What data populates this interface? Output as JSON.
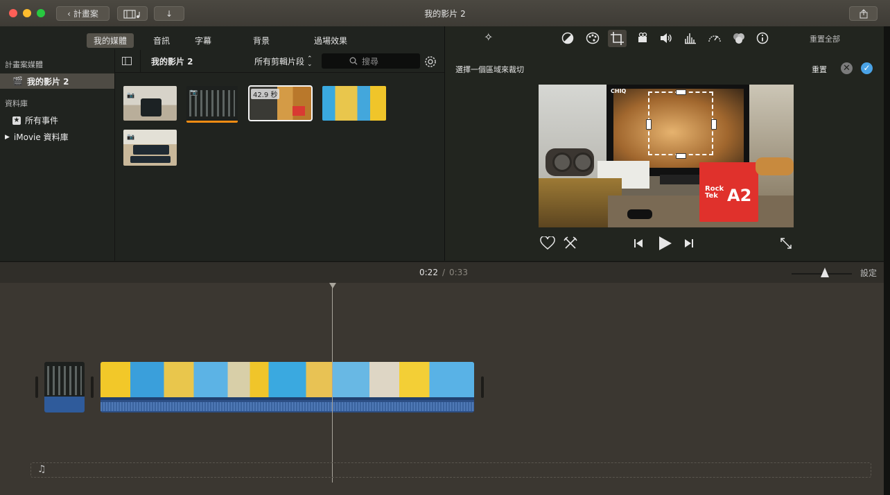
{
  "window": {
    "title": "我的影片 2",
    "back_label": "計畫案",
    "colors": {
      "close": "#fe5f57",
      "minimize": "#febc2e",
      "zoom": "#28c840"
    }
  },
  "media_tabs": [
    "我的媒體",
    "音訊",
    "字幕",
    "背景",
    "過場效果"
  ],
  "sidebar": {
    "project_section": "計畫案媒體",
    "project_item": "我的影片 2",
    "library_section": "資料庫",
    "library_items": [
      "所有事件",
      "iMovie 資料庫"
    ]
  },
  "browser": {
    "title": "我的影片 2",
    "filter": "所有剪輯片段",
    "search_placeholder": "搜尋",
    "selected_clip_duration": "42.9 秒"
  },
  "inspector": {
    "reset_all": "重置全部",
    "crop_prompt": "選擇一個區域來裁切",
    "reset": "重置"
  },
  "viewer_overlay": {
    "brand": "CHIQ",
    "box_text_1": "Rock",
    "box_text_2": "Tek",
    "box_model": "A2"
  },
  "timeline": {
    "current_time": "0:22",
    "separator": "/",
    "total_time": "0:33",
    "settings": "設定",
    "zoom_level": 0.55
  }
}
